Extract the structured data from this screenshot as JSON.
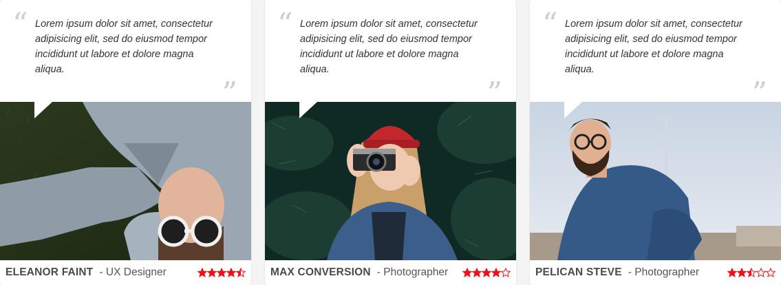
{
  "testimonials": [
    {
      "quote": "Lorem ipsum dolor sit amet, consectetur adipisicing elit, sed do eiusmod tempor incididunt ut labore et dolore magna aliqua.",
      "name": "ELEANOR FAINT",
      "role": "- UX Designer",
      "rating": 4.5,
      "max_rating": 5,
      "photo_icon": "person-lying-on-grass-photo"
    },
    {
      "quote": "Lorem ipsum dolor sit amet, consectetur adipisicing elit, sed do eiusmod tempor incididunt ut labore et dolore magna aliqua.",
      "name": "MAX CONVERSION",
      "role": "- Photographer",
      "rating": 4,
      "max_rating": 5,
      "photo_icon": "woman-with-camera-photo"
    },
    {
      "quote": "Lorem ipsum dolor sit amet, consectetur adipisicing elit, sed do eiusmod tempor incididunt ut labore et dolore magna aliqua.",
      "name": "PELICAN STEVE",
      "role": "- Photographer",
      "rating": 2.5,
      "max_rating": 5,
      "photo_icon": "bearded-man-photo"
    }
  ],
  "colors": {
    "star": "#e8141c",
    "quote_mark": "#cfcfcf",
    "name": "#4a4a4a"
  }
}
